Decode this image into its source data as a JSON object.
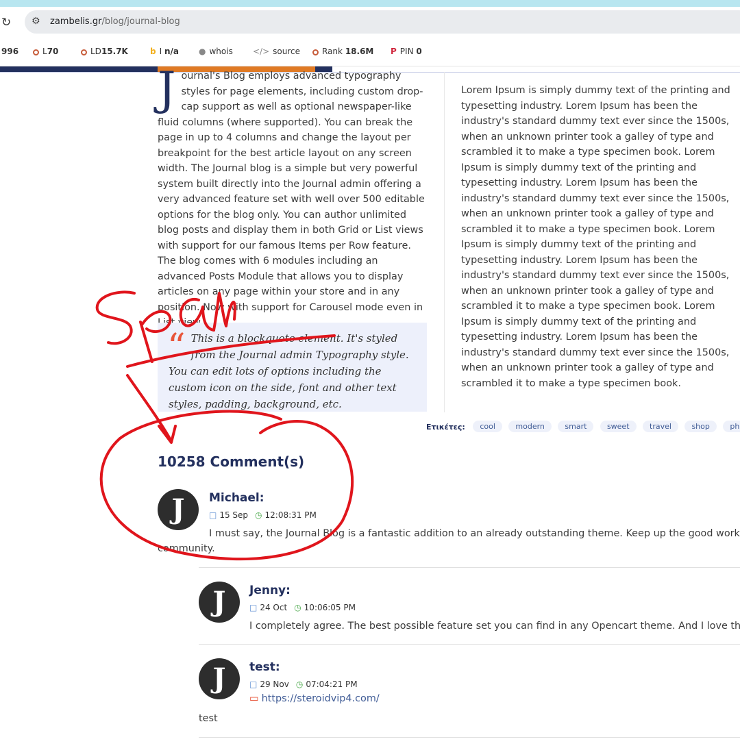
{
  "browser": {
    "url_domain": "zambelis.gr",
    "url_path": "/blog/journal-blog",
    "reload_icon": "reload-icon",
    "tune_icon": "site-settings-icon"
  },
  "seo_toolbar": [
    {
      "name": "partial",
      "label": "996",
      "value": ""
    },
    {
      "name": "l",
      "label": "L",
      "value": "70"
    },
    {
      "name": "ld",
      "label": "LD",
      "value": "15.7K"
    },
    {
      "name": "bing",
      "label": "I",
      "value": "n/a"
    },
    {
      "name": "whois",
      "label": "whois",
      "value": ""
    },
    {
      "name": "source",
      "label": "source",
      "value": ""
    },
    {
      "name": "rank",
      "label": "Rank",
      "value": "18.6M"
    },
    {
      "name": "pin",
      "label": "PIN",
      "value": "0"
    }
  ],
  "article": {
    "dropcap": "J",
    "first_line": "ournal's Blog employs advanced typography styles",
    "body": "for page elements, including custom drop-cap support as well as optional newspaper-like fluid columns (where supported). You can break the page in up to 4 columns and change the layout per breakpoint for the best article layout on any screen width. The Journal blog is a simple but very powerful system built directly into the Journal admin offering a very advanced feature set with well over 500 editable options for the blog only. You can author unlimited blog posts and display them in both Grid or List views with support for our famous Items per Row feature. The blog comes with 6 modules including an advanced Posts Module that allows you to display articles on any page within your store and in any position. Now with support for Carousel mode even in List view.",
    "blockquote": "This is a blockquote element. It's styled from the Journal admin Typography style. You can edit lots of options including the custom icon on the side, font and other text styles, padding, background, etc."
  },
  "lorem": "Lorem Ipsum is simply dummy text of the printing and typesetting industry. Lorem Ipsum has been the industry's standard dummy text ever since the 1500s, when an unknown printer took a galley of type and scrambled it to make a type specimen book. Lorem Ipsum is simply dummy text of the printing and typesetting industry. Lorem Ipsum has been the industry's standard dummy text ever since the 1500s, when an unknown printer took a galley of type and scrambled it to make a type specimen book. Lorem Ipsum is simply dummy text of the printing and typesetting industry. Lorem Ipsum has been the industry's standard dummy text ever since the 1500s, when an unknown printer took a galley of type and scrambled it to make a type specimen book. Lorem Ipsum is simply dummy text of the printing and typesetting industry. Lorem Ipsum has been the industry's standard dummy text ever since the 1500s, when an unknown printer took a galley of type and scrambled it to make a type specimen book.",
  "tags": {
    "label": "Ετικέτες:",
    "items": [
      "cool",
      "modern",
      "smart",
      "sweet",
      "travel",
      "shop",
      "photogra"
    ]
  },
  "comments": {
    "title": "10258 Comment(s)",
    "avatar_letter": "J",
    "items": [
      {
        "name": "Michael:",
        "date": "15 Sep",
        "time": "12:08:31 PM",
        "text_1": "I must say, the Journal Blog is a fantastic addition to an already outstanding theme. Keep up the good work guys",
        "text_2": "community."
      },
      {
        "name": "Jenny:",
        "date": "24 Oct",
        "time": "10:06:05 PM",
        "text_1": "I completely agree. The best possible feature set you can find in any Opencart theme. And I love the Gr"
      },
      {
        "name": "test:",
        "date": "29 Nov",
        "time": "07:04:21 PM",
        "link": "https://steroidvip4.com/",
        "text_1": "test"
      }
    ]
  },
  "annotation": {
    "handwritten_word": "Spam",
    "ink_color": "#e0151c"
  }
}
